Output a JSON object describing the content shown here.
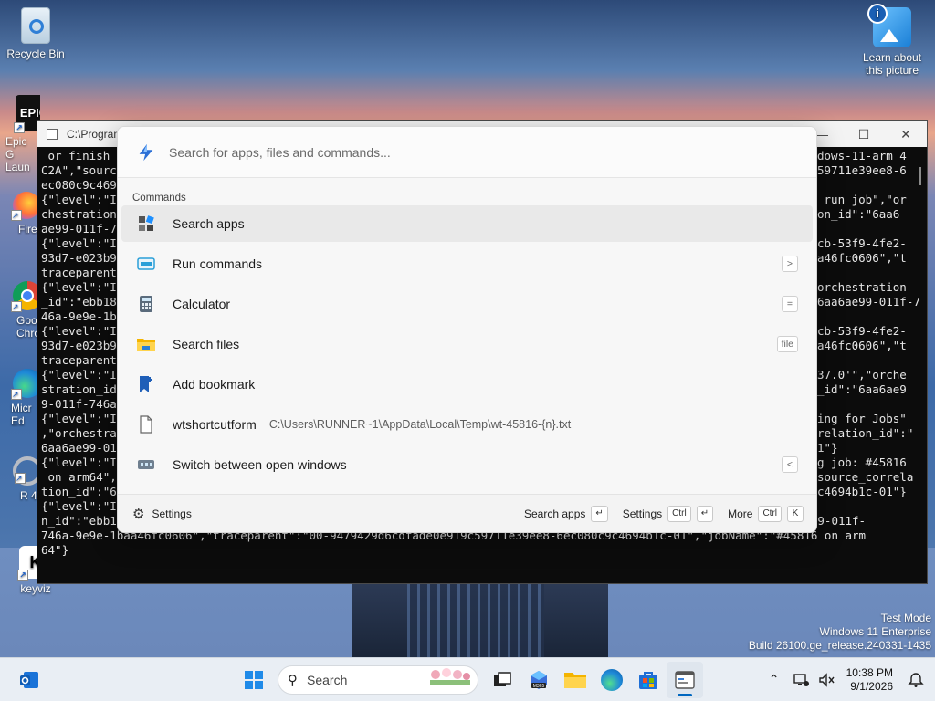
{
  "desktop": {
    "icons": [
      {
        "label": "Recycle Bin"
      },
      {
        "label": "Epic G Laun"
      },
      {
        "label": "Fire"
      },
      {
        "label": "Goo Chro"
      },
      {
        "label": "Micr Ed"
      },
      {
        "label": "R 4"
      },
      {
        "label": "keyviz"
      },
      {
        "label": "Learn about this picture"
      }
    ]
  },
  "terminal": {
    "title": "C:\\Program",
    "left_lines": [
      " or finish ",
      "C2A\",\"sourc",
      "ec080c9c469",
      "{\"level\":\"I",
      "chestration",
      "ae99-011f-7",
      "{\"level\":\"I",
      "93d7-e023b9",
      "traceparent\"",
      "{\"level\":\"I",
      "_id\":\"ebb18",
      "46a-9e9e-1b",
      "{\"level\":\"I",
      "93d7-e023b9",
      "traceparent\"",
      "{\"level\":\"I",
      "stration_id",
      "9-011f-746a",
      "{\"level\":\"I",
      ",\"orchestra",
      "6aa6ae99-01",
      "{\"level\":\"I",
      " on arm64\",",
      "tion_id\":\"6"
    ],
    "right_lines": [
      "dows-11-arm_4",
      "59711e39ee8-6",
      "",
      " run job\",\"or",
      "on_id\":\"6aa6",
      "",
      "cb-53f9-4fe2-",
      "a46fc0606\",\"t",
      "",
      "orchestration",
      "6aa6ae99-011f-7",
      "",
      "cb-53f9-4fe2-",
      "a46fc0606\",\"t",
      "",
      "37.0'\",\"orche",
      "_id\":\"6aa6ae9",
      "",
      "ing for Jobs\"",
      "relation_id\":\"",
      "1\"}",
      "g job: #45816",
      "source_correla",
      "c4694b1c-01\"}"
    ],
    "bottom_lines": [
      "{\"level\":\"I                                                                                    orchestratio",
      "n_id\":\"ebb188cb-53f9-4fe2-93d7-e023b91542c4.reproduce.arm64_windows-11-arm_4C2A\",\"source_correlation_id\":\"6aa6ae99-011f-",
      "746a-9e9e-1baa46fc0606\",\"traceparent\":\"00-9479429d6cdfade0e919c59711e39ee8-6ec080c9c4694b1c-01\",\"jobName\":\"#45816 on arm",
      "64\"}"
    ]
  },
  "palette": {
    "search_placeholder": "Search for apps, files and commands...",
    "section_label": "Commands",
    "items": [
      {
        "label": "Search apps",
        "sub": "",
        "key": "",
        "icon": "apps-icon"
      },
      {
        "label": "Run commands",
        "sub": "",
        "key": ">",
        "icon": "terminal-icon"
      },
      {
        "label": "Calculator",
        "sub": "",
        "key": "=",
        "icon": "calculator-icon"
      },
      {
        "label": "Search files",
        "sub": "",
        "key": "file",
        "icon": "folder-icon"
      },
      {
        "label": "Add bookmark",
        "sub": "",
        "key": "",
        "icon": "bookmark-icon"
      },
      {
        "label": "wtshortcutform",
        "sub": "C:\\Users\\RUNNER~1\\AppData\\Local\\Temp\\wt-45816-{n}.txt",
        "key": "",
        "icon": "file-icon"
      },
      {
        "label": "Switch between open windows",
        "sub": "",
        "key": "<",
        "icon": "window-switch-icon"
      }
    ],
    "footer": {
      "settings_label": "Settings",
      "search_apps_label": "Search apps",
      "settings_right_label": "Settings",
      "ctrl_key": "Ctrl",
      "more_label": "More",
      "ctrl_key2": "Ctrl",
      "k_key": "K",
      "enter_glyph": "↵"
    }
  },
  "watermark": {
    "line1": "Test Mode",
    "line2": "Windows 11 Enterprise",
    "line3": "Build 26100.ge_release.240331-1435"
  },
  "taskbar": {
    "search_label": "Search",
    "time": "10:38 PM",
    "date": "9/1/2026"
  }
}
